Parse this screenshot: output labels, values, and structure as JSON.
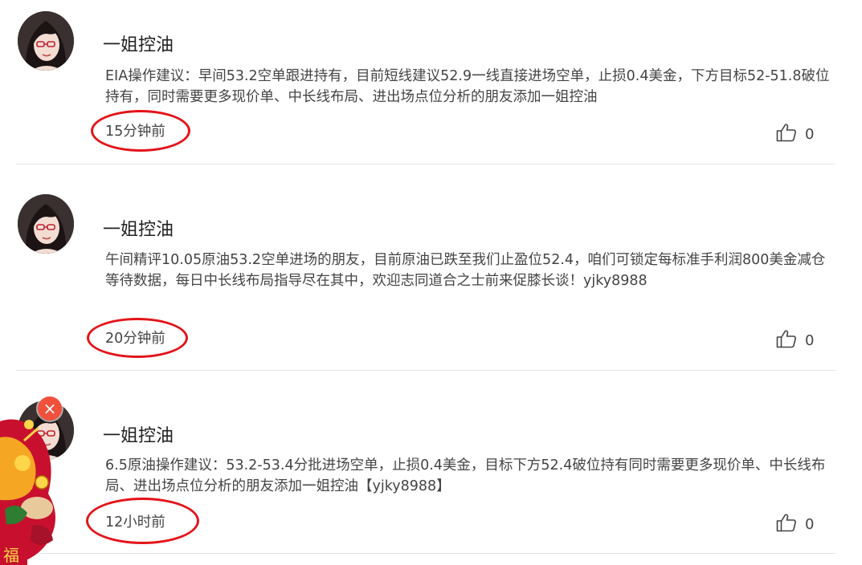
{
  "colors": {
    "highlight_circle": "#e3141a",
    "close_badge": "#f0513d",
    "divider": "#e3e3e3"
  },
  "posts": [
    {
      "author": "一姐控油",
      "content": "EIA操作建议：早间53.2空单跟进持有，目前短线建议52.9一线直接进场空单，止损0.4美金，下方目标52-51.8破位持有，同时需要更多现价单、中长线布局、进出场点位分析的朋友添加一姐控油",
      "time": "15分钟前",
      "likes": "0",
      "icon": "thumbs-up-icon"
    },
    {
      "author": "一姐控油",
      "content": "午间精评10.05原油53.2空单进场的朋友，目前原油已跌至我们止盈位52.4，咱们可锁定每标准手利润800美金减仓等待数据，每日中长线布局指导尽在其中，欢迎志同道合之士前来促膝长谈！yjky8988",
      "time": "20分钟前",
      "likes": "0",
      "icon": "thumbs-up-icon"
    },
    {
      "author": "一姐控油",
      "content": "6.5原油操作建议：53.2-53.4分批进场空单，止损0.4美金，目标下方52.4破位持有同时需要更多现价单、中长线布局、进出场点位分析的朋友添加一姐控油【yjky8988】",
      "time": "12小时前",
      "likes": "0",
      "icon": "thumbs-up-icon"
    }
  ],
  "overlay": {
    "close_icon": "close-icon",
    "close_glyph": "×",
    "ad_text": "福"
  }
}
